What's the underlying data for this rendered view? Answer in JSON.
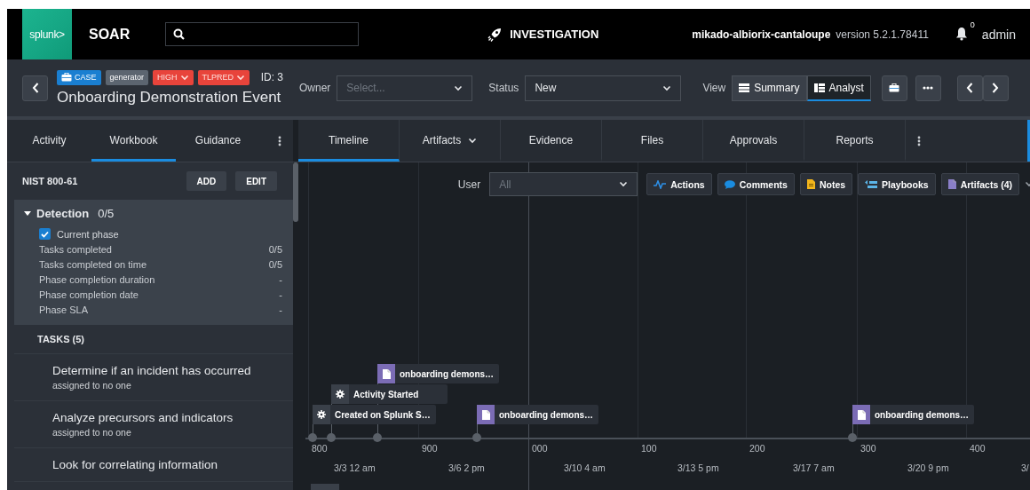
{
  "top_bar": {
    "logo": "splunk>",
    "product": "SOAR",
    "section": "INVESTIGATION",
    "instance": "mikado-albiorix-cantaloupe",
    "version": "version 5.2.1.78411",
    "notifications": "0",
    "user": "admin"
  },
  "case": {
    "badges": [
      {
        "kind": "type",
        "label": "CASE",
        "dropdown": false
      },
      {
        "kind": "tag",
        "label": "generator",
        "dropdown": false
      },
      {
        "kind": "severity",
        "label": "HIGH",
        "dropdown": true
      },
      {
        "kind": "sensitivity",
        "label": "TLPRED",
        "dropdown": true
      }
    ],
    "id": "ID: 3",
    "title": "Onboarding Demonstration Event",
    "owner": {
      "label": "Owner",
      "placeholder": "Select..."
    },
    "status": {
      "label": "Status",
      "value": "New"
    },
    "view": {
      "label": "View",
      "options": [
        {
          "kind": "summary",
          "label": "Summary",
          "selected": false
        },
        {
          "kind": "analyst",
          "label": "Analyst",
          "selected": true
        }
      ]
    }
  },
  "left_panel": {
    "tabs": [
      {
        "label": "Activity",
        "selected": false
      },
      {
        "label": "Workbook",
        "selected": true
      },
      {
        "label": "Guidance",
        "selected": false
      }
    ],
    "workbook": {
      "name": "NIST 800-61",
      "buttons": [
        "ADD",
        "EDIT"
      ],
      "phase": {
        "name": "Detection",
        "progress": "0/5",
        "expanded": true,
        "current": {
          "label": "Current phase",
          "checked": true
        },
        "stats": [
          {
            "label": "Tasks completed",
            "value": "0/5"
          },
          {
            "label": "Tasks completed on time",
            "value": "0/5"
          },
          {
            "label": "Phase completion duration",
            "value": "-"
          },
          {
            "label": "Phase completion date",
            "value": "-"
          },
          {
            "label": "Phase SLA",
            "value": "-"
          }
        ]
      },
      "tasks_heading": "TASKS (5)",
      "tasks": [
        {
          "title": "Determine if an incident has occurred",
          "assignee": "assigned to no one"
        },
        {
          "title": "Analyze precursors and indicators",
          "assignee": "assigned to no one"
        },
        {
          "title": "Look for correlating information"
        }
      ]
    }
  },
  "main_panel": {
    "tabs": [
      {
        "label": "Timeline",
        "selected": true,
        "dropdown": false
      },
      {
        "label": "Artifacts",
        "selected": false,
        "dropdown": true
      },
      {
        "label": "Evidence",
        "selected": false,
        "dropdown": false
      },
      {
        "label": "Files",
        "selected": false,
        "dropdown": false
      },
      {
        "label": "Approvals",
        "selected": false,
        "dropdown": false
      },
      {
        "label": "Reports",
        "selected": false,
        "dropdown": false
      }
    ],
    "filters": {
      "user": {
        "label": "User",
        "placeholder": "All"
      },
      "buttons": [
        {
          "kind": "actions",
          "label": "Actions"
        },
        {
          "kind": "comments",
          "label": "Comments"
        },
        {
          "kind": "notes",
          "label": "Notes"
        },
        {
          "kind": "playbooks",
          "label": "Playbooks"
        },
        {
          "kind": "artifacts",
          "label": "Artifacts (4)"
        }
      ]
    },
    "timeline": {
      "events": [
        {
          "kind": "artifact",
          "label": "onboarding demons…"
        },
        {
          "kind": "system",
          "label": "Activity Started"
        },
        {
          "kind": "system",
          "label": "Created on Splunk S…"
        },
        {
          "kind": "artifact",
          "label": "onboarding demons…"
        },
        {
          "kind": "artifact",
          "label": "onboarding demons…"
        }
      ],
      "ticks": [
        "800",
        "900",
        "000",
        "100",
        "200",
        "300",
        "400"
      ],
      "dates": [
        "3/3 12 am",
        "3/6 2 pm",
        "3/10 4 am",
        "3/13 5 pm",
        "3/17 7 am",
        "3/20 9 pm",
        "3/"
      ]
    }
  }
}
